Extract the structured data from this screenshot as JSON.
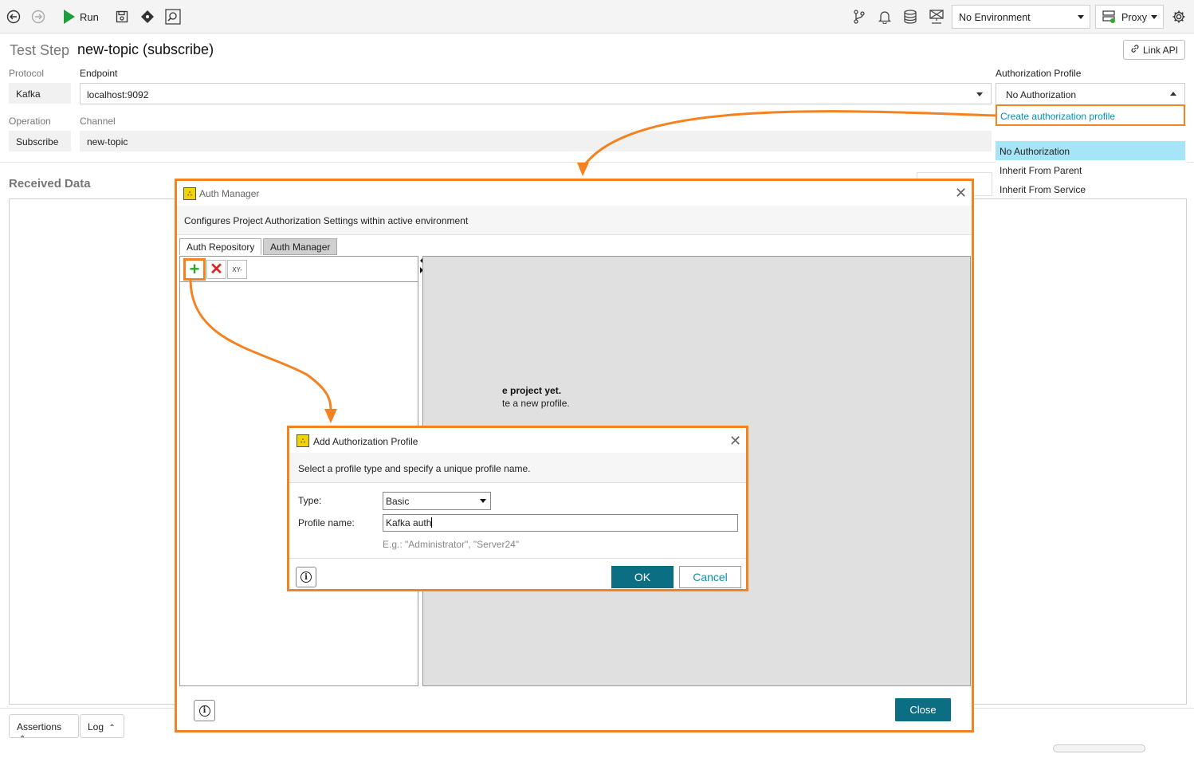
{
  "toolbar": {
    "run_label": "Run",
    "environment": "No Environment",
    "proxy_label": "Proxy"
  },
  "header": {
    "title_prefix": "Test Step",
    "title": "new-topic (subscribe)",
    "link_api_label": "Link API"
  },
  "fields": {
    "protocol_label": "Protocol",
    "protocol_value": "Kafka",
    "endpoint_label": "Endpoint",
    "endpoint_value": "localhost:9092",
    "operation_label": "Operation",
    "operation_value": "Subscribe",
    "channel_label": "Channel",
    "channel_value": "new-topic",
    "auth_profile_label": "Authorization Profile",
    "auth_profile_value": "No Authorization"
  },
  "auth_dropdown": {
    "create_label": "Create authorization profile",
    "options": [
      "No Authorization",
      "Inherit From Parent",
      "Inherit From Service"
    ],
    "selected": "No Authorization"
  },
  "received": {
    "label": "Received Data"
  },
  "bottom_tabs": {
    "assertions": "Assertions",
    "log": "Log"
  },
  "auth_manager": {
    "title": "Auth Manager",
    "description": "Configures Project Authorization Settings within active environment",
    "tabs": [
      "Auth Repository",
      "Auth Manager"
    ],
    "tools": {
      "xyz_label": "XY-"
    },
    "empty_line1": "e project yet.",
    "empty_line2": "te a new profile.",
    "close_label": "Close"
  },
  "add_profile": {
    "title": "Add Authorization Profile",
    "description": "Select a profile type and specify a unique profile name.",
    "type_label": "Type:",
    "type_value": "Basic",
    "name_label": "Profile name:",
    "name_value": "Kafka auth",
    "hint": "E.g.: \"Administrator\", \"Server24\"",
    "ok_label": "OK",
    "cancel_label": "Cancel"
  },
  "colors": {
    "highlight": "#f58220",
    "accent": "#0b6e82",
    "link": "#0a8fb0",
    "selected_option": "#a6e4f7"
  }
}
